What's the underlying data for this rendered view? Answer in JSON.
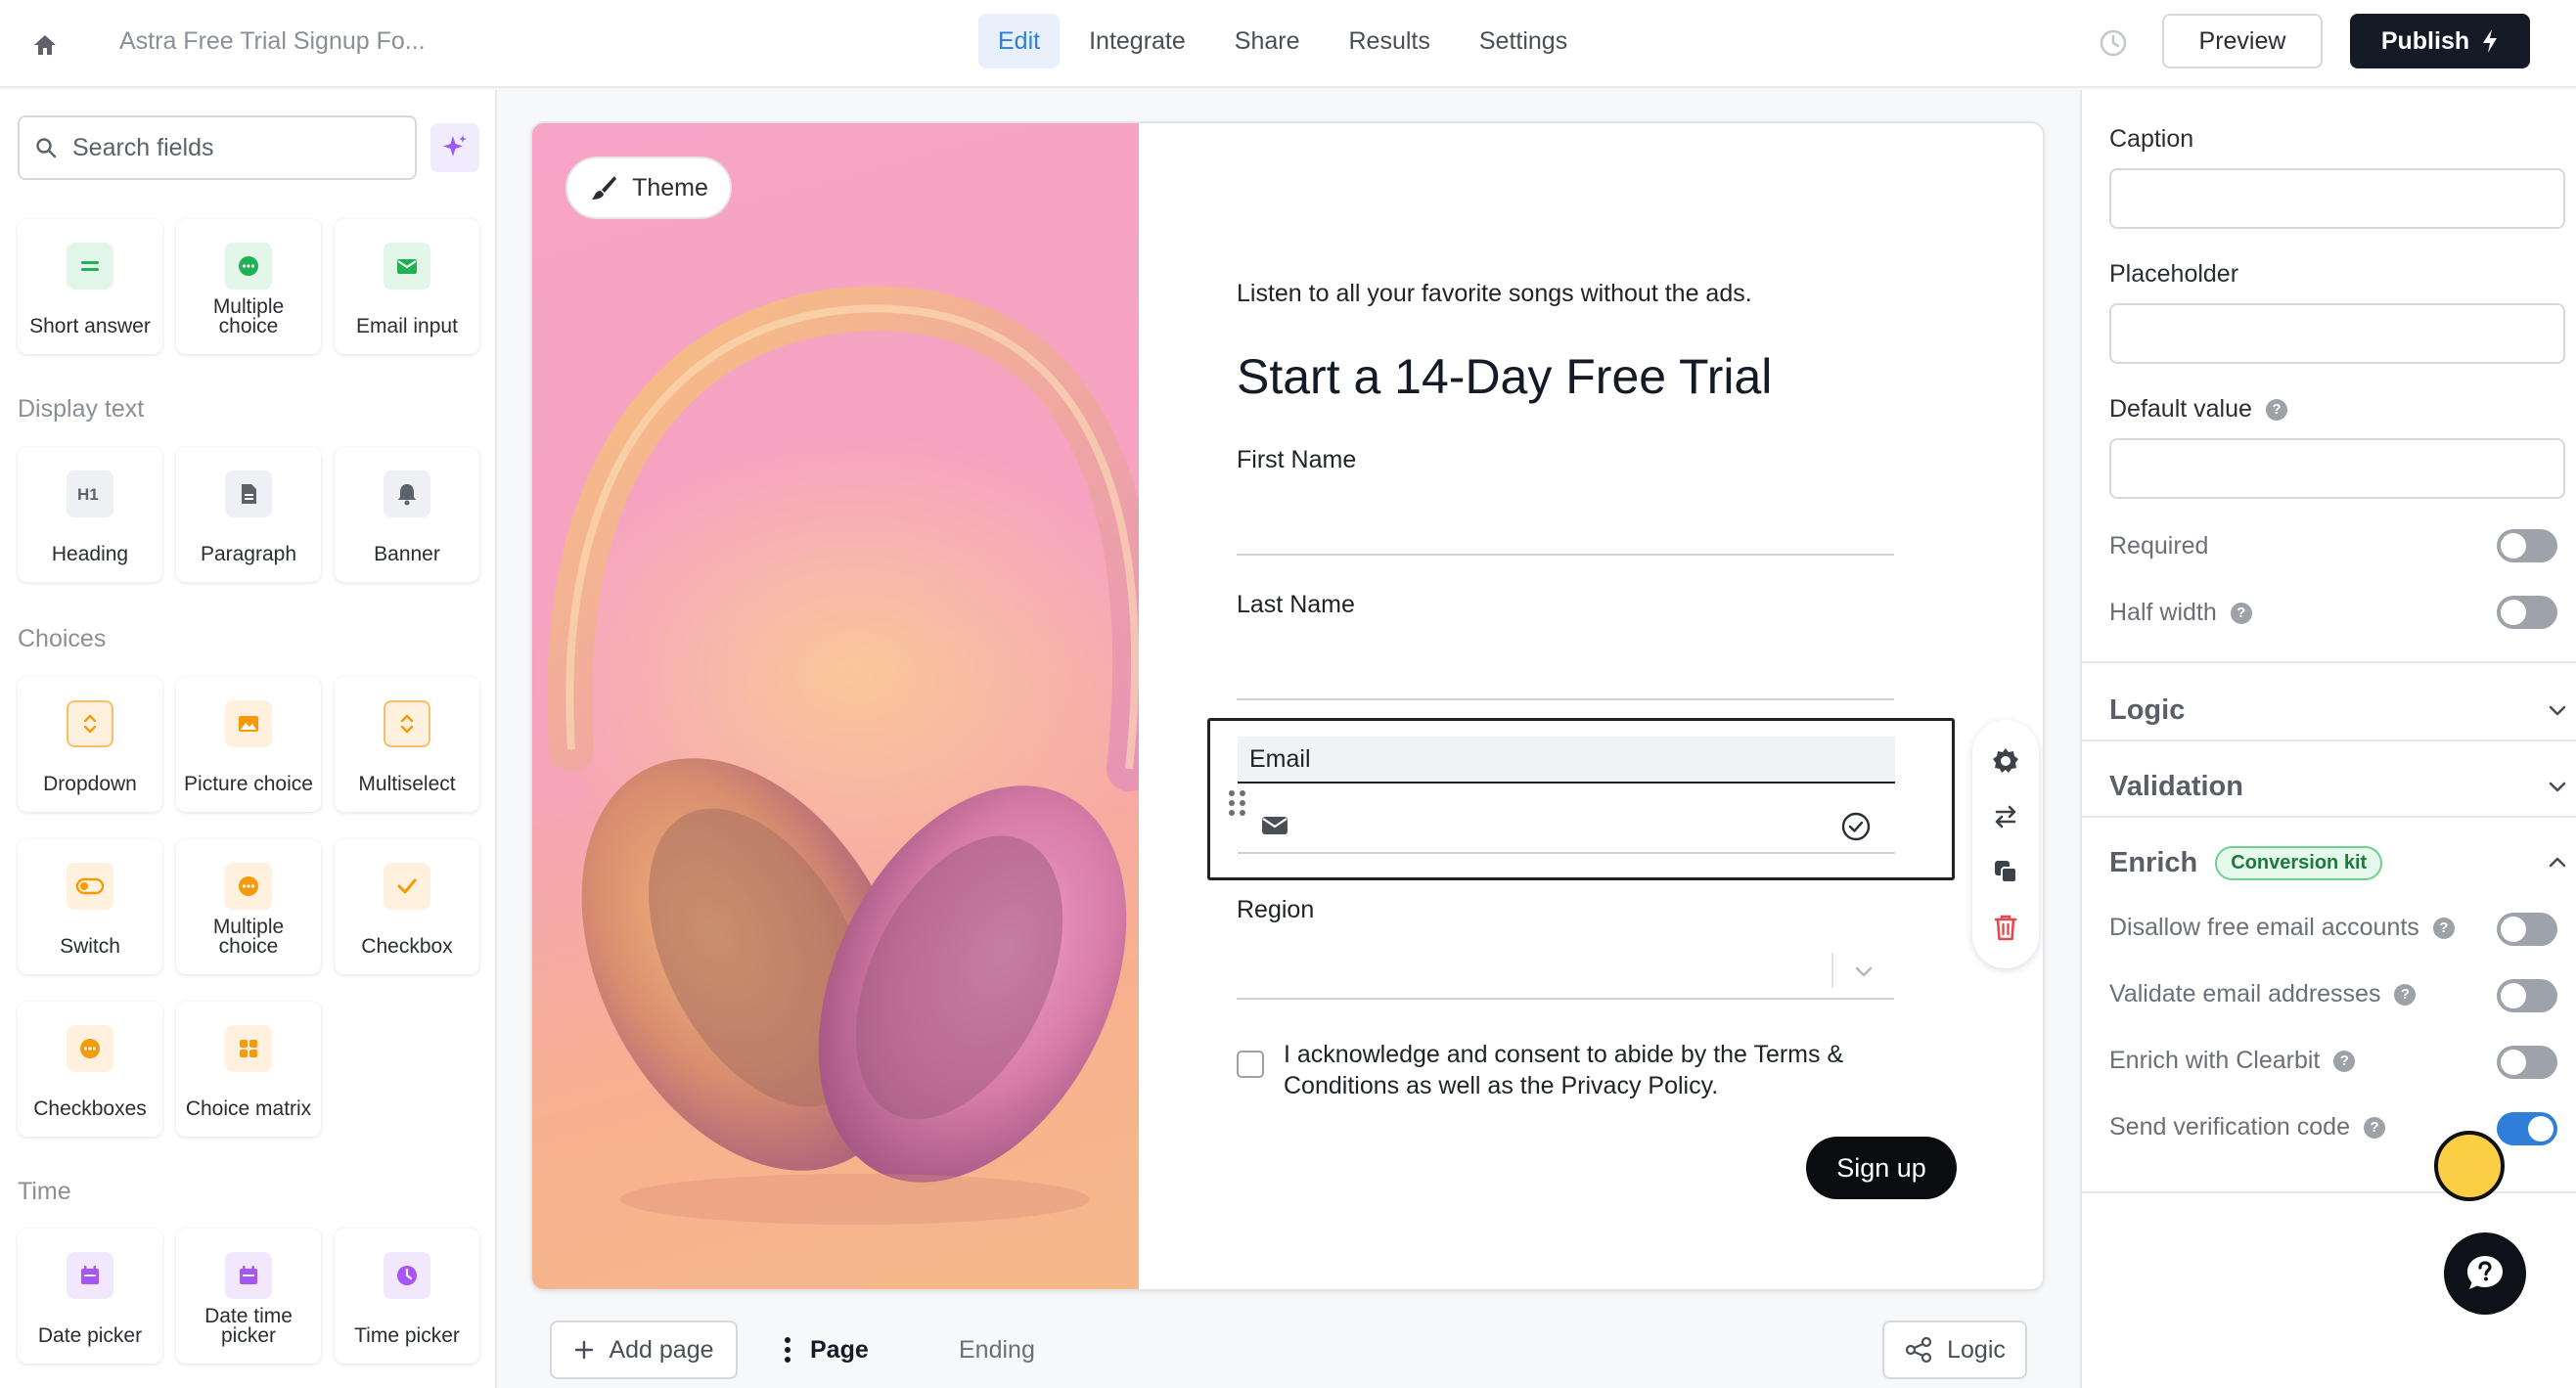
{
  "topbar": {
    "form_title": "Astra Free Trial Signup Fo...",
    "tabs": [
      {
        "label": "Edit",
        "active": true
      },
      {
        "label": "Integrate"
      },
      {
        "label": "Share"
      },
      {
        "label": "Results"
      },
      {
        "label": "Settings"
      }
    ],
    "preview_label": "Preview",
    "publish_label": "Publish"
  },
  "sidebar": {
    "search_placeholder": "Search fields",
    "basic_fields": [
      {
        "label": "Short answer",
        "icon": "short-answer-icon"
      },
      {
        "label": "Multiple choice",
        "icon": "multiple-choice-icon"
      },
      {
        "label": "Email input",
        "icon": "email-icon"
      }
    ],
    "display_text_title": "Display text",
    "display_text_fields": [
      {
        "label": "Heading",
        "icon": "heading-icon"
      },
      {
        "label": "Paragraph",
        "icon": "paragraph-icon"
      },
      {
        "label": "Banner",
        "icon": "bell-icon"
      }
    ],
    "choices_title": "Choices",
    "choice_fields": [
      {
        "label": "Dropdown",
        "icon": "dropdown-icon"
      },
      {
        "label": "Picture choice",
        "icon": "picture-icon"
      },
      {
        "label": "Multiselect",
        "icon": "multiselect-icon"
      },
      {
        "label": "Switch",
        "icon": "switch-icon"
      },
      {
        "label": "Multiple choice",
        "icon": "multiple-choice-icon"
      },
      {
        "label": "Checkbox",
        "icon": "checkbox-icon"
      },
      {
        "label": "Checkboxes",
        "icon": "checkboxes-icon"
      },
      {
        "label": "Choice matrix",
        "icon": "grid-icon"
      }
    ],
    "time_title": "Time",
    "time_fields": [
      {
        "label": "Date picker",
        "icon": "calendar-icon"
      },
      {
        "label": "Date time picker",
        "icon": "calendar-icon"
      },
      {
        "label": "Time picker",
        "icon": "clock-icon"
      }
    ]
  },
  "canvas": {
    "theme_label": "Theme",
    "tagline": "Listen to all your favorite songs without the ads.",
    "heading": "Start a 14-Day Free Trial",
    "first_name_label": "First Name",
    "last_name_label": "Last Name",
    "email_label": "Email",
    "region_label": "Region",
    "consent_text": "I acknowledge and consent to abide by the Terms & Conditions as well as the Privacy Policy.",
    "submit_label": "Sign up"
  },
  "pages_bar": {
    "add_page_label": "Add page",
    "page_label": "Page",
    "ending_label": "Ending",
    "logic_label": "Logic"
  },
  "settings": {
    "caption_label": "Caption",
    "placeholder_label": "Placeholder",
    "default_value_label": "Default value",
    "required_label": "Required",
    "required_on": false,
    "half_width_label": "Half width",
    "half_width_on": false,
    "logic_section": "Logic",
    "validation_section": "Validation",
    "enrich_section": "Enrich",
    "enrich_badge": "Conversion kit",
    "enrich_options": [
      {
        "label": "Disallow free email accounts",
        "on": false
      },
      {
        "label": "Validate email addresses",
        "on": false
      },
      {
        "label": "Enrich with Clearbit",
        "on": false
      },
      {
        "label": "Send verification code",
        "on": true
      }
    ]
  },
  "colors": {
    "accent": "#2f7fd8",
    "publish_bg": "#141a26",
    "badge_green": "#1d7a3d",
    "danger": "#e5484d"
  }
}
